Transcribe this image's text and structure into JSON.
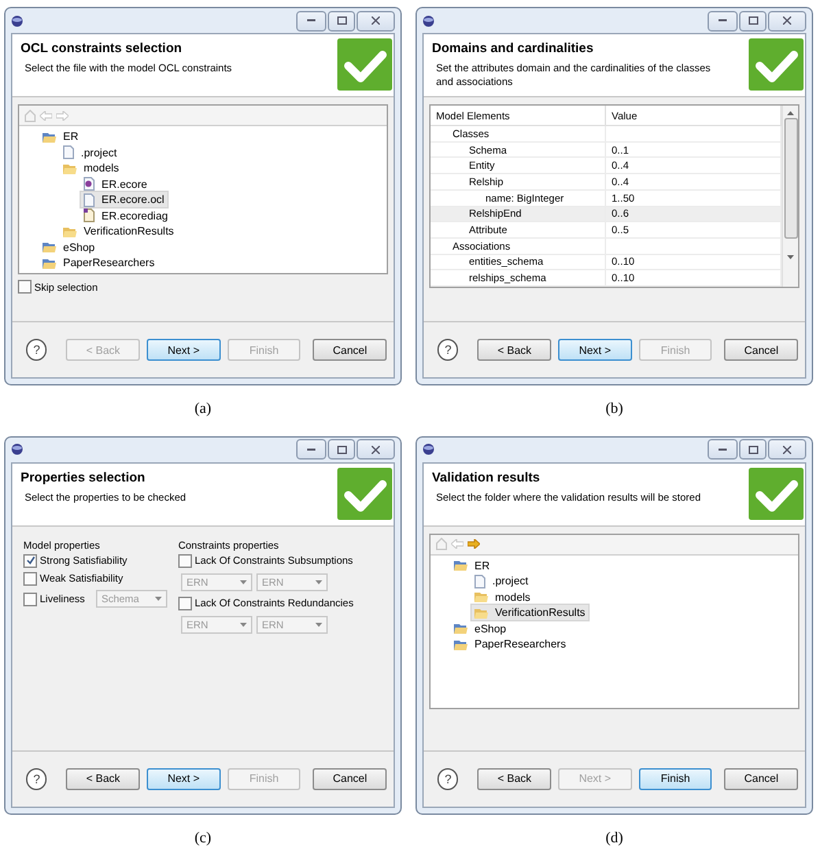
{
  "panels": [
    {
      "caption": "(a)",
      "title": "OCL constraints selection",
      "subtitle": "Select the file with the model OCL constraints",
      "kind": "tree",
      "nav": [
        {
          "kind": "home",
          "enabled": false
        },
        {
          "kind": "back",
          "enabled": false
        },
        {
          "kind": "forward",
          "enabled": false
        }
      ],
      "tree": [
        {
          "label": "ER",
          "kind": "project",
          "selected": false,
          "children": [
            {
              "label": ".project",
              "kind": "file",
              "selected": false
            },
            {
              "label": "models",
              "kind": "folder",
              "selected": false,
              "children": [
                {
                  "label": "ER.ecore",
                  "kind": "ecore",
                  "selected": false
                },
                {
                  "label": "ER.ecore.ocl",
                  "kind": "file",
                  "selected": true
                },
                {
                  "label": "ER.ecorediag",
                  "kind": "diag",
                  "selected": false
                }
              ]
            },
            {
              "label": "VerificationResults",
              "kind": "folder",
              "selected": false
            }
          ]
        },
        {
          "label": "eShop",
          "kind": "project",
          "selected": false
        },
        {
          "label": "PaperResearchers",
          "kind": "project",
          "selected": false
        }
      ],
      "skip": {
        "label": "Skip selection",
        "checked": false
      },
      "help": "?",
      "buttons": [
        {
          "label": "< Back",
          "disabled": true,
          "default": false
        },
        {
          "label": "Next >",
          "disabled": false,
          "default": true
        },
        {
          "label": "Finish",
          "disabled": true,
          "default": false
        },
        {
          "label": "Cancel",
          "disabled": false,
          "default": false
        }
      ]
    },
    {
      "caption": "(b)",
      "title": "Domains and cardinalities",
      "subtitle": "Set the attributes domain and the cardinalities of the classes and associations",
      "kind": "table",
      "table": {
        "columns": [
          "Model Elements",
          "Value"
        ],
        "rows": [
          {
            "name": "Classes",
            "selected": false,
            "children": [
              {
                "name": "Schema",
                "value": "0..1",
                "selected": false
              },
              {
                "name": "Entity",
                "value": "0..4",
                "selected": false
              },
              {
                "name": "Relship",
                "value": "0..4",
                "selected": false,
                "children": [
                  {
                    "name": "name: BigInteger",
                    "value": "1..50",
                    "selected": false
                  }
                ]
              },
              {
                "name": "RelshipEnd",
                "value": "0..6",
                "selected": true
              },
              {
                "name": "Attribute",
                "value": "0..5",
                "selected": false
              }
            ]
          },
          {
            "name": "Associations",
            "selected": false,
            "children": [
              {
                "name": "entities_schema",
                "value": "0..10",
                "selected": false
              },
              {
                "name": "relships_schema",
                "value": "0..10",
                "selected": false
              }
            ]
          }
        ]
      },
      "help": "?",
      "buttons": [
        {
          "label": "< Back",
          "disabled": false,
          "default": false
        },
        {
          "label": "Next >",
          "disabled": false,
          "default": true
        },
        {
          "label": "Finish",
          "disabled": true,
          "default": false
        },
        {
          "label": "Cancel",
          "disabled": false,
          "default": false
        }
      ]
    },
    {
      "caption": "(c)",
      "title": "Properties selection",
      "subtitle": "Select the properties to be checked",
      "kind": "properties",
      "groups": [
        {
          "title": "Model properties",
          "items": [
            {
              "kind": "check",
              "label": "Strong Satisfiability",
              "checked": true
            },
            {
              "kind": "check",
              "label": "Weak Satisfiability",
              "checked": false
            },
            {
              "kind": "check_combo",
              "label": "Liveliness",
              "checked": false,
              "combos": [
                {
                  "value": "Schema",
                  "disabled": true
                }
              ]
            }
          ]
        },
        {
          "title": "Constraints properties",
          "items": [
            {
              "kind": "check",
              "label": "Lack Of Constraints Subsumptions",
              "checked": false
            },
            {
              "kind": "combos",
              "combos": [
                {
                  "value": "ERN",
                  "disabled": true
                },
                {
                  "value": "ERN",
                  "disabled": true
                }
              ]
            },
            {
              "kind": "check",
              "label": "Lack Of Constraints Redundancies",
              "checked": false
            },
            {
              "kind": "combos",
              "combos": [
                {
                  "value": "ERN",
                  "disabled": true
                },
                {
                  "value": "ERN",
                  "disabled": true
                }
              ]
            }
          ]
        }
      ],
      "help": "?",
      "buttons": [
        {
          "label": "< Back",
          "disabled": false,
          "default": false
        },
        {
          "label": "Next >",
          "disabled": false,
          "default": true
        },
        {
          "label": "Finish",
          "disabled": true,
          "default": false
        },
        {
          "label": "Cancel",
          "disabled": false,
          "default": false
        }
      ]
    },
    {
      "caption": "(d)",
      "title": "Validation results",
      "subtitle": "Select the folder where the validation results will be stored",
      "kind": "tree",
      "nav": [
        {
          "kind": "home",
          "enabled": false
        },
        {
          "kind": "back",
          "enabled": false
        },
        {
          "kind": "forward",
          "enabled": true
        }
      ],
      "tree": [
        {
          "label": "ER",
          "kind": "project",
          "selected": false,
          "children": [
            {
              "label": ".project",
              "kind": "file",
              "selected": false
            },
            {
              "label": "models",
              "kind": "folder",
              "selected": false
            },
            {
              "label": "VerificationResults",
              "kind": "folder",
              "selected": true
            }
          ]
        },
        {
          "label": "eShop",
          "kind": "project",
          "selected": false
        },
        {
          "label": "PaperResearchers",
          "kind": "project",
          "selected": false
        }
      ],
      "help": "?",
      "buttons": [
        {
          "label": "< Back",
          "disabled": false,
          "default": false
        },
        {
          "label": "Next >",
          "disabled": true,
          "default": false
        },
        {
          "label": "Finish",
          "disabled": false,
          "default": true
        },
        {
          "label": "Cancel",
          "disabled": false,
          "default": false
        }
      ]
    }
  ]
}
